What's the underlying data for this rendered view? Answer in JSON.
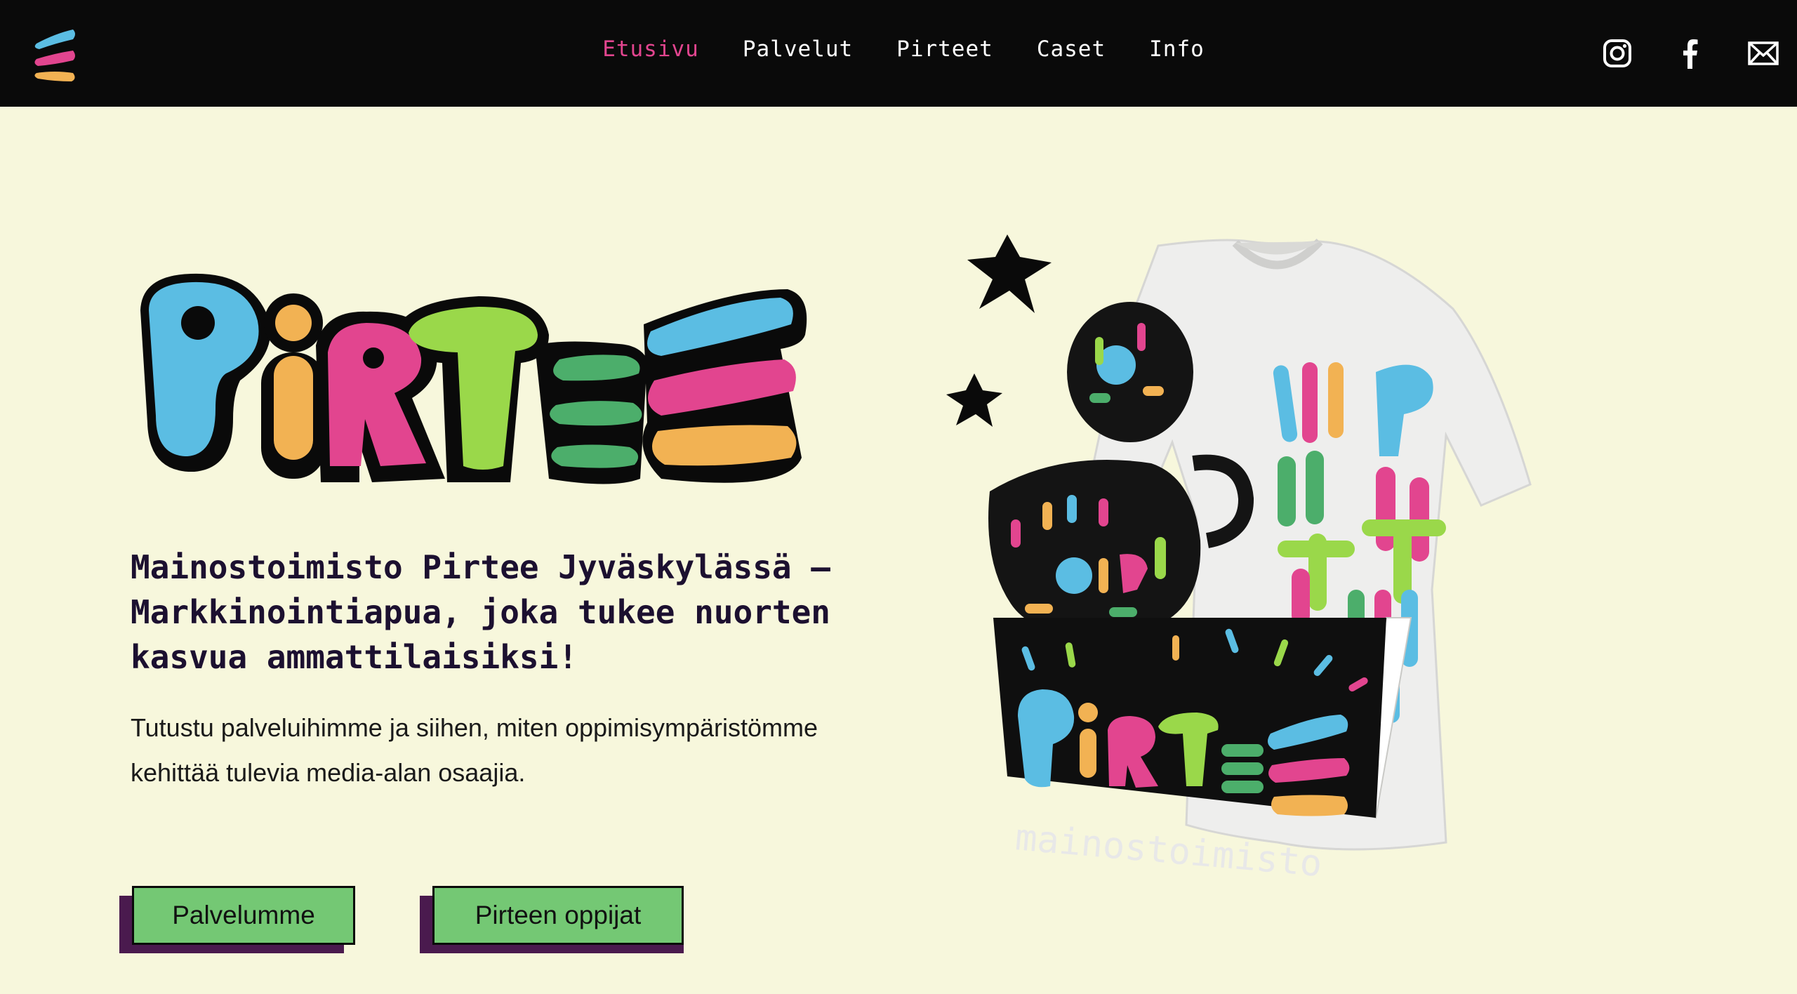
{
  "nav": {
    "items": [
      {
        "label": "Etusivu",
        "active": true
      },
      {
        "label": "Palvelut",
        "active": false
      },
      {
        "label": "Pirteet",
        "active": false
      },
      {
        "label": "Caset",
        "active": false
      },
      {
        "label": "Info",
        "active": false
      }
    ],
    "social_icons": [
      "instagram-icon",
      "facebook-icon",
      "mail-icon"
    ]
  },
  "hero": {
    "logo_text": "PiRTEE",
    "headline": "Mainostoimisto Pirtee Jyväskylässä – Markkinointiapua, joka tukee nuorten kasvua ammattilaisiksi!",
    "subtext": "Tutustu palveluihimme ja siihen, miten oppimisympäristömme kehittää tulevia media-alan osaajia.",
    "buttons": [
      {
        "label": "Palvelumme"
      },
      {
        "label": "Pirteen oppijat"
      }
    ],
    "sign_text": "mainostoimisto"
  },
  "colors": {
    "background": "#f7f7dc",
    "topbar": "#0a0a0a",
    "accent_pink": "#e2458f",
    "brand_blue": "#5bbde3",
    "brand_orange": "#f2b253",
    "brand_green": "#9ad84a",
    "brand_dark_green": "#4cae6b",
    "button_green": "#74c874",
    "button_shadow": "#4a1a4e",
    "headline": "#1c1030"
  }
}
